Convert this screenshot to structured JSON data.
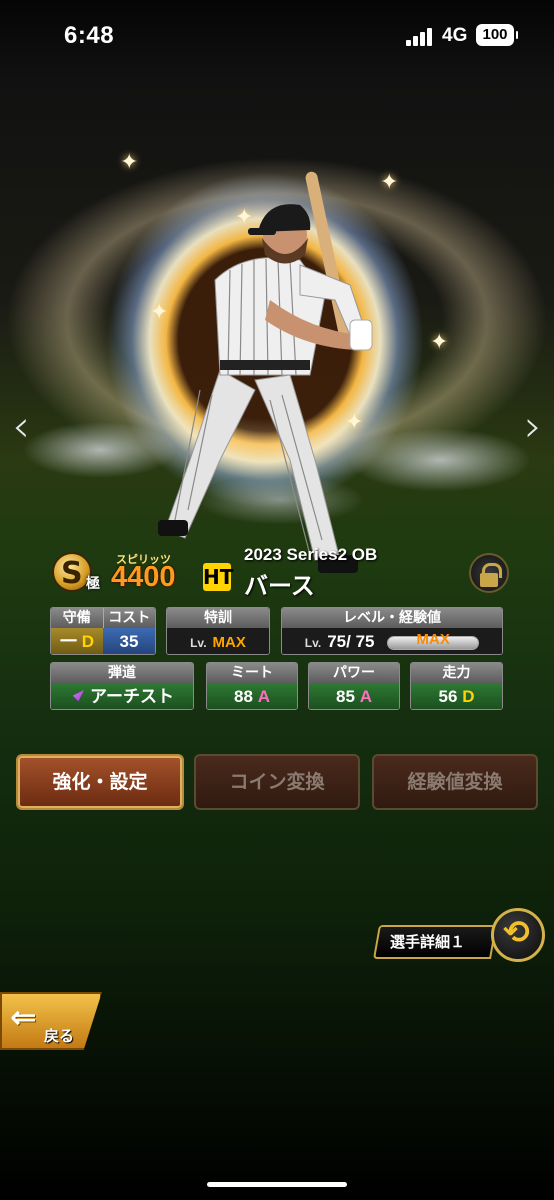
{
  "status_bar": {
    "time": "6:48",
    "network": "4G",
    "battery": "100"
  },
  "card": {
    "rank_letter": "S",
    "rank_suffix": "極",
    "spirits_label": "スピリッツ",
    "spirits_value": "4400",
    "team_logo": "HT",
    "series": "2023 Series2 OB",
    "player_name": "バース"
  },
  "stats": {
    "position_label": "守備",
    "position_value": "一",
    "position_grade": "D",
    "cost_label": "コスト",
    "cost_value": "35",
    "training_label": "特訓",
    "training_lv": "Lv.",
    "training_value": "MAX",
    "level_label": "レベル・経験値",
    "level_lv": "Lv.",
    "level_value": "75/ 75",
    "exp_value": "MAX",
    "exp_fraction": 1.0,
    "trajectory_label": "弾道",
    "trajectory_value": "アーチスト",
    "meet_label": "ミート",
    "meet_value": "88",
    "meet_grade": "A",
    "power_label": "パワー",
    "power_value": "85",
    "power_grade": "A",
    "speed_label": "走力",
    "speed_value": "56",
    "speed_grade": "D"
  },
  "actions": {
    "enhance_label": "強化・設定",
    "coin_label": "コイン変換",
    "exp_label": "経験値変換"
  },
  "detail": {
    "label": "選手詳細１"
  },
  "back": {
    "label": "戻る"
  },
  "nav": {
    "prev": "‹",
    "next": "›"
  },
  "icons": [
    "rank-badge-icon",
    "team-logo-icon",
    "lock-icon",
    "trajectory-arrow-icon",
    "swap-icon",
    "back-arrow-icon"
  ]
}
